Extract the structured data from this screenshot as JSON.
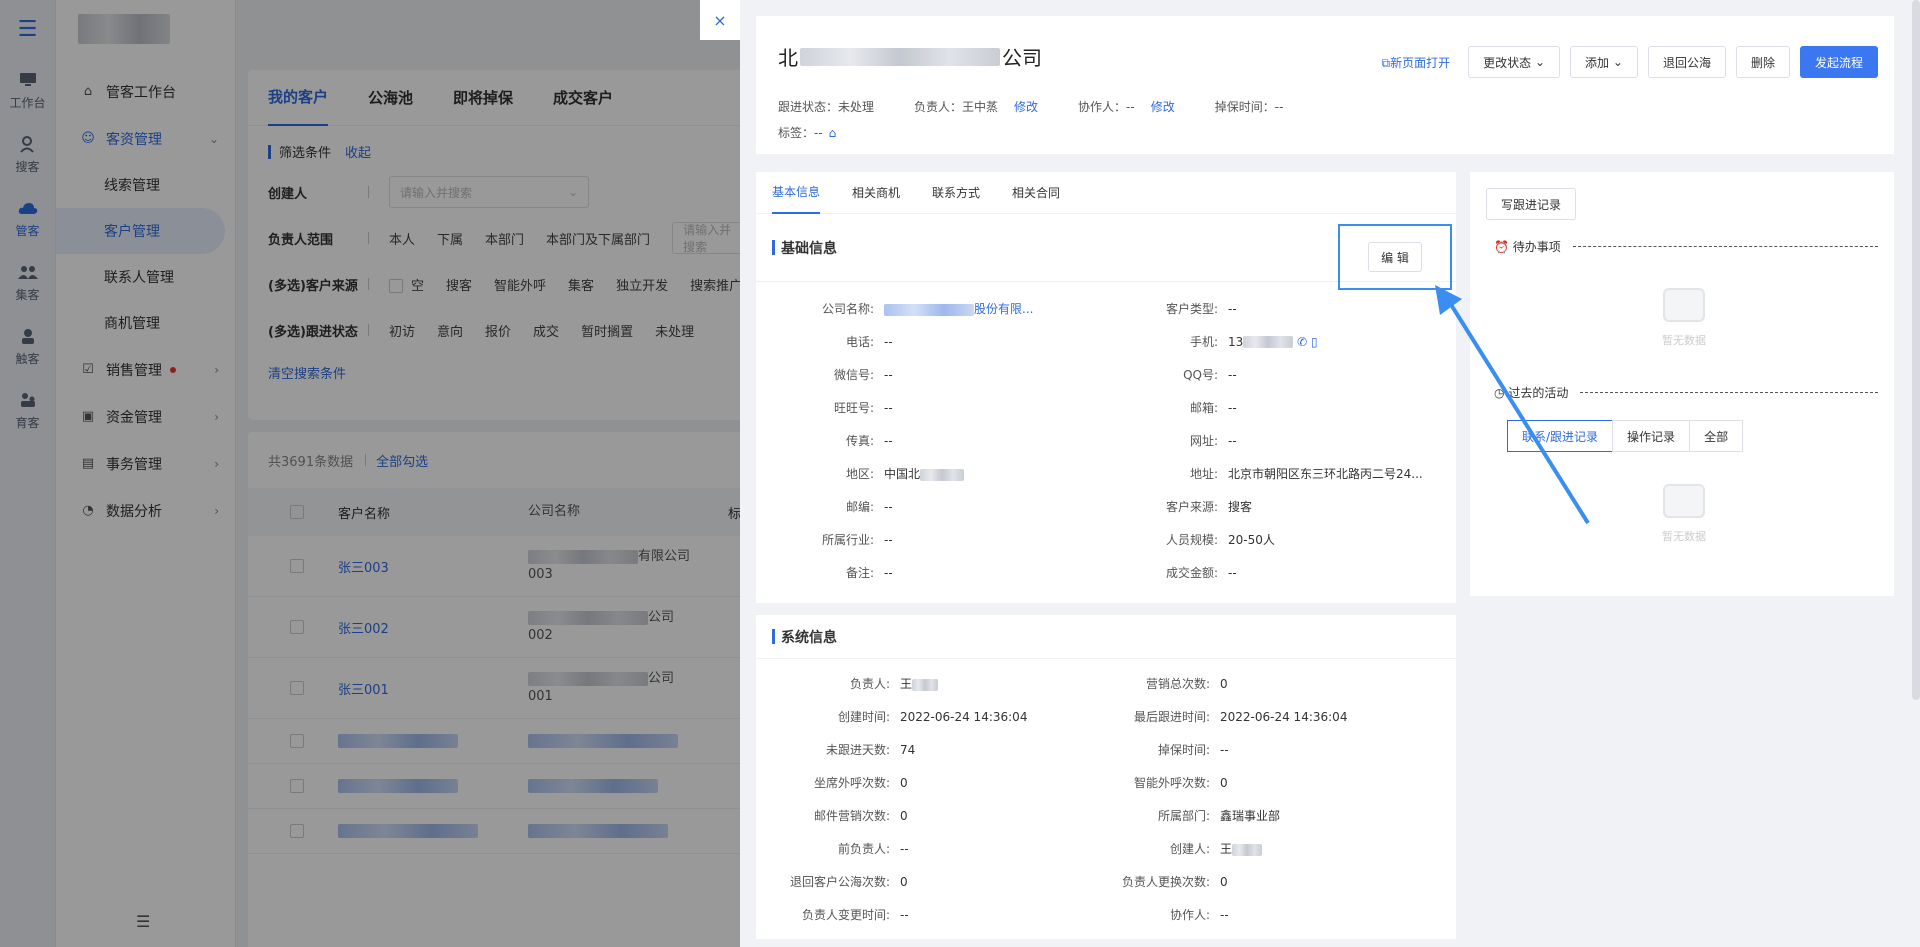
{
  "rail": [
    {
      "label": "工作台",
      "icon": "monitor-icon"
    },
    {
      "label": "搜客",
      "icon": "user-search-icon"
    },
    {
      "label": "管客",
      "icon": "cloud-icon"
    },
    {
      "label": "集客",
      "icon": "group-icon"
    },
    {
      "label": "触客",
      "icon": "contact-icon"
    },
    {
      "label": "育客",
      "icon": "nurture-icon"
    }
  ],
  "sidebar": {
    "items": [
      {
        "label": "管客工作台"
      },
      {
        "label": "客资管理"
      },
      {
        "label": "线索管理"
      },
      {
        "label": "客户管理"
      },
      {
        "label": "联系人管理"
      },
      {
        "label": "商机管理"
      },
      {
        "label": "销售管理"
      },
      {
        "label": "资金管理"
      },
      {
        "label": "事务管理"
      },
      {
        "label": "数据分析"
      }
    ]
  },
  "main": {
    "tabs": [
      "我的客户",
      "公海池",
      "即将掉保",
      "成交客户"
    ],
    "filter_title": "筛选条件",
    "filter_collapse": "收起",
    "filters": {
      "creator_label": "创建人",
      "creator_placeholder": "请输入并搜索",
      "owner_label": "负责人范围",
      "owner_opts": [
        "本人",
        "下属",
        "本部门",
        "本部门及下属部门"
      ],
      "owner_placeholder": "请输入并搜索",
      "source_label": "(多选)客户来源",
      "source_opts": [
        "空",
        "搜客",
        "智能外呼",
        "集客",
        "独立开发",
        "搜索推广"
      ],
      "status_label": "(多选)跟进状态",
      "status_opts": [
        "初访",
        "意向",
        "报价",
        "成交",
        "暂时搁置",
        "未处理"
      ]
    },
    "clear": "清空搜索条件",
    "total": "共3691条数据",
    "select_all": "全部勾选",
    "columns": [
      "客户名称",
      "公司名称",
      "标"
    ],
    "rows": [
      {
        "name": "张三003",
        "comp_a": "有限公司",
        "comp_b": "003"
      },
      {
        "name": "张三002",
        "comp_a": "公司",
        "comp_b": "002"
      },
      {
        "name": "张三001",
        "comp_a": "公司",
        "comp_b": "001"
      }
    ]
  },
  "drawer": {
    "close": "×",
    "title_prefix": "北",
    "title_suffix": "公司",
    "new_page": "新页面打开",
    "btn_status": "更改状态",
    "btn_add": "添加",
    "btn_return": "退回公海",
    "btn_delete": "删除",
    "btn_flow": "发起流程",
    "meta": {
      "follow": "跟进状态：未处理",
      "owner": "负责人：王中蒸",
      "owner_edit": "修改",
      "assist": "协作人：--",
      "assist_edit": "修改",
      "drop": "掉保时间：--",
      "tag": "标签：--"
    },
    "tabs": [
      "基本信息",
      "相关商机",
      "联系方式",
      "相关合同"
    ],
    "basic_title": "基础信息",
    "edit": "编 辑",
    "basic": [
      {
        "k": "公司名称:",
        "v": "股份有限...",
        "k2": "客户类型:",
        "v2": "--"
      },
      {
        "k": "电话:",
        "v": "--",
        "k2": "手机:",
        "v2": "13"
      },
      {
        "k": "微信号:",
        "v": "--",
        "k2": "QQ号:",
        "v2": "--"
      },
      {
        "k": "旺旺号:",
        "v": "--",
        "k2": "邮箱:",
        "v2": "--"
      },
      {
        "k": "传真:",
        "v": "--",
        "k2": "网址:",
        "v2": "--"
      },
      {
        "k": "地区:",
        "v": "中国北",
        "k2": "地址:",
        "v2": "北京市朝阳区东三环北路丙二号24..."
      },
      {
        "k": "邮编:",
        "v": "--",
        "k2": "客户来源:",
        "v2": "搜客"
      },
      {
        "k": "所属行业:",
        "v": "--",
        "k2": "人员规模:",
        "v2": "20-50人"
      },
      {
        "k": "备注:",
        "v": "--",
        "k2": "成交金额:",
        "v2": "--"
      }
    ],
    "sys_title": "系统信息",
    "sys": [
      {
        "k": "负责人:",
        "v": "王",
        "k2": "营销总次数:",
        "v2": "0"
      },
      {
        "k": "创建时间:",
        "v": "2022-06-24 14:36:04",
        "k2": "最后跟进时间:",
        "v2": "2022-06-24 14:36:04"
      },
      {
        "k": "未跟进天数:",
        "v": "74",
        "k2": "掉保时间:",
        "v2": "--"
      },
      {
        "k": "坐席外呼次数:",
        "v": "0",
        "k2": "智能外呼次数:",
        "v2": "0"
      },
      {
        "k": "邮件营销次数:",
        "v": "0",
        "k2": "所属部门:",
        "v2": "鑫瑞事业部"
      },
      {
        "k": "前负责人:",
        "v": "--",
        "k2": "创建人:",
        "v2": "王"
      },
      {
        "k": "退回客户公海次数:",
        "v": "0",
        "k2": "负责人更换次数:",
        "v2": "0"
      },
      {
        "k": "负责人变更时间:",
        "v": "--",
        "k2": "协作人:",
        "v2": "--"
      }
    ],
    "right": {
      "write": "写跟进记录",
      "todo": "待办事项",
      "empty": "暂无数据",
      "past": "过去的活动",
      "seg": [
        "联系/跟进记录",
        "操作记录",
        "全部"
      ]
    }
  }
}
